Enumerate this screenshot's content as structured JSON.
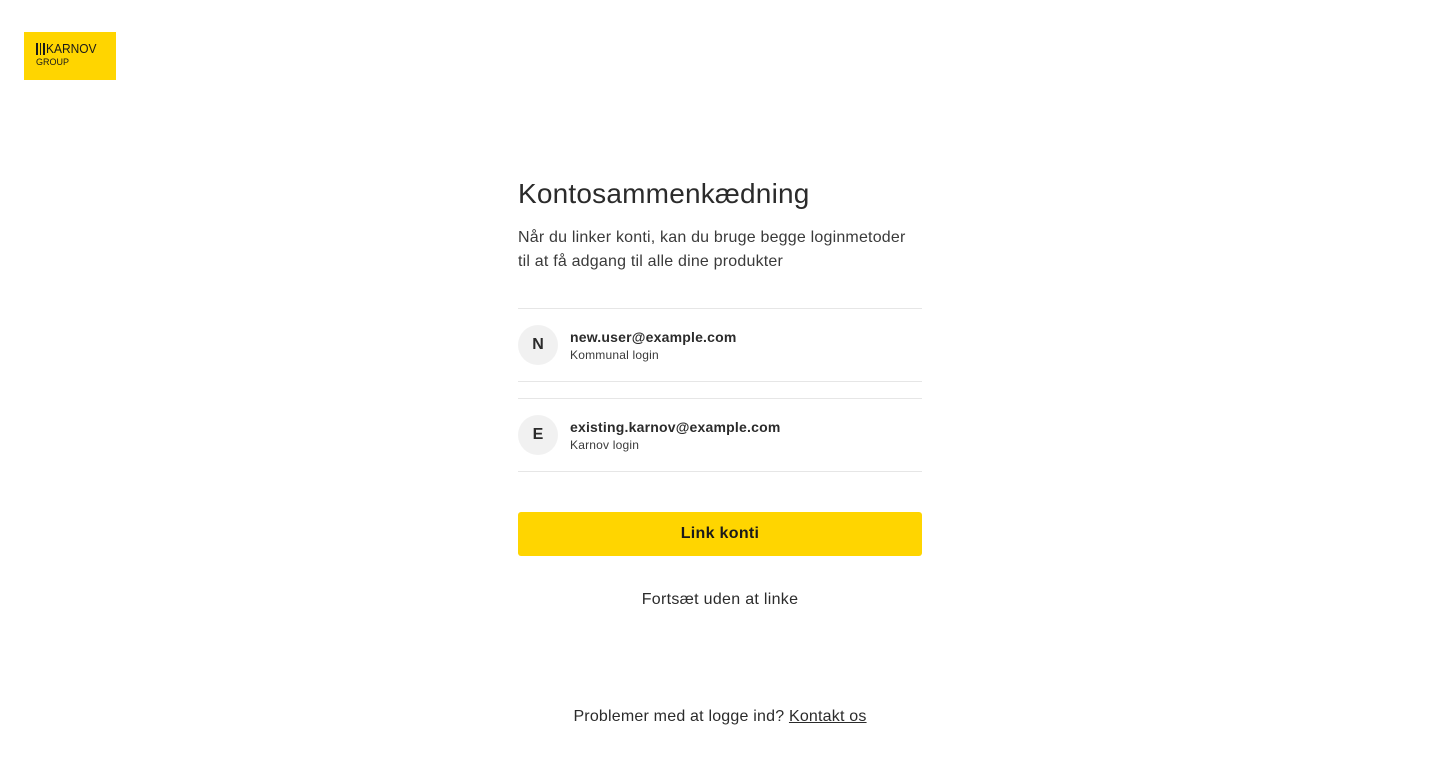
{
  "logo": {
    "brand": "KARNOV",
    "sub": "GROUP",
    "background": "#ffd500"
  },
  "main": {
    "title": "Kontosammenkædning",
    "subtitle": "Når du linker konti, kan du bruge begge loginmetoder til at få adgang til alle dine produkter",
    "accounts": [
      {
        "initial": "N",
        "email": "new.user@example.com",
        "method": "Kommunal login"
      },
      {
        "initial": "E",
        "email": "existing.karnov@example.com",
        "method": "Karnov login"
      }
    ],
    "link_button_label": "Link konti",
    "continue_label": "Fortsæt uden at linke"
  },
  "footer": {
    "text": "Problemer med at logge ind?",
    "contact_label": "Kontakt os"
  },
  "colors": {
    "accent": "#ffd500",
    "text": "#2b2b2b",
    "divider": "#e6e6e6",
    "avatar_bg": "#f1f1f1"
  }
}
